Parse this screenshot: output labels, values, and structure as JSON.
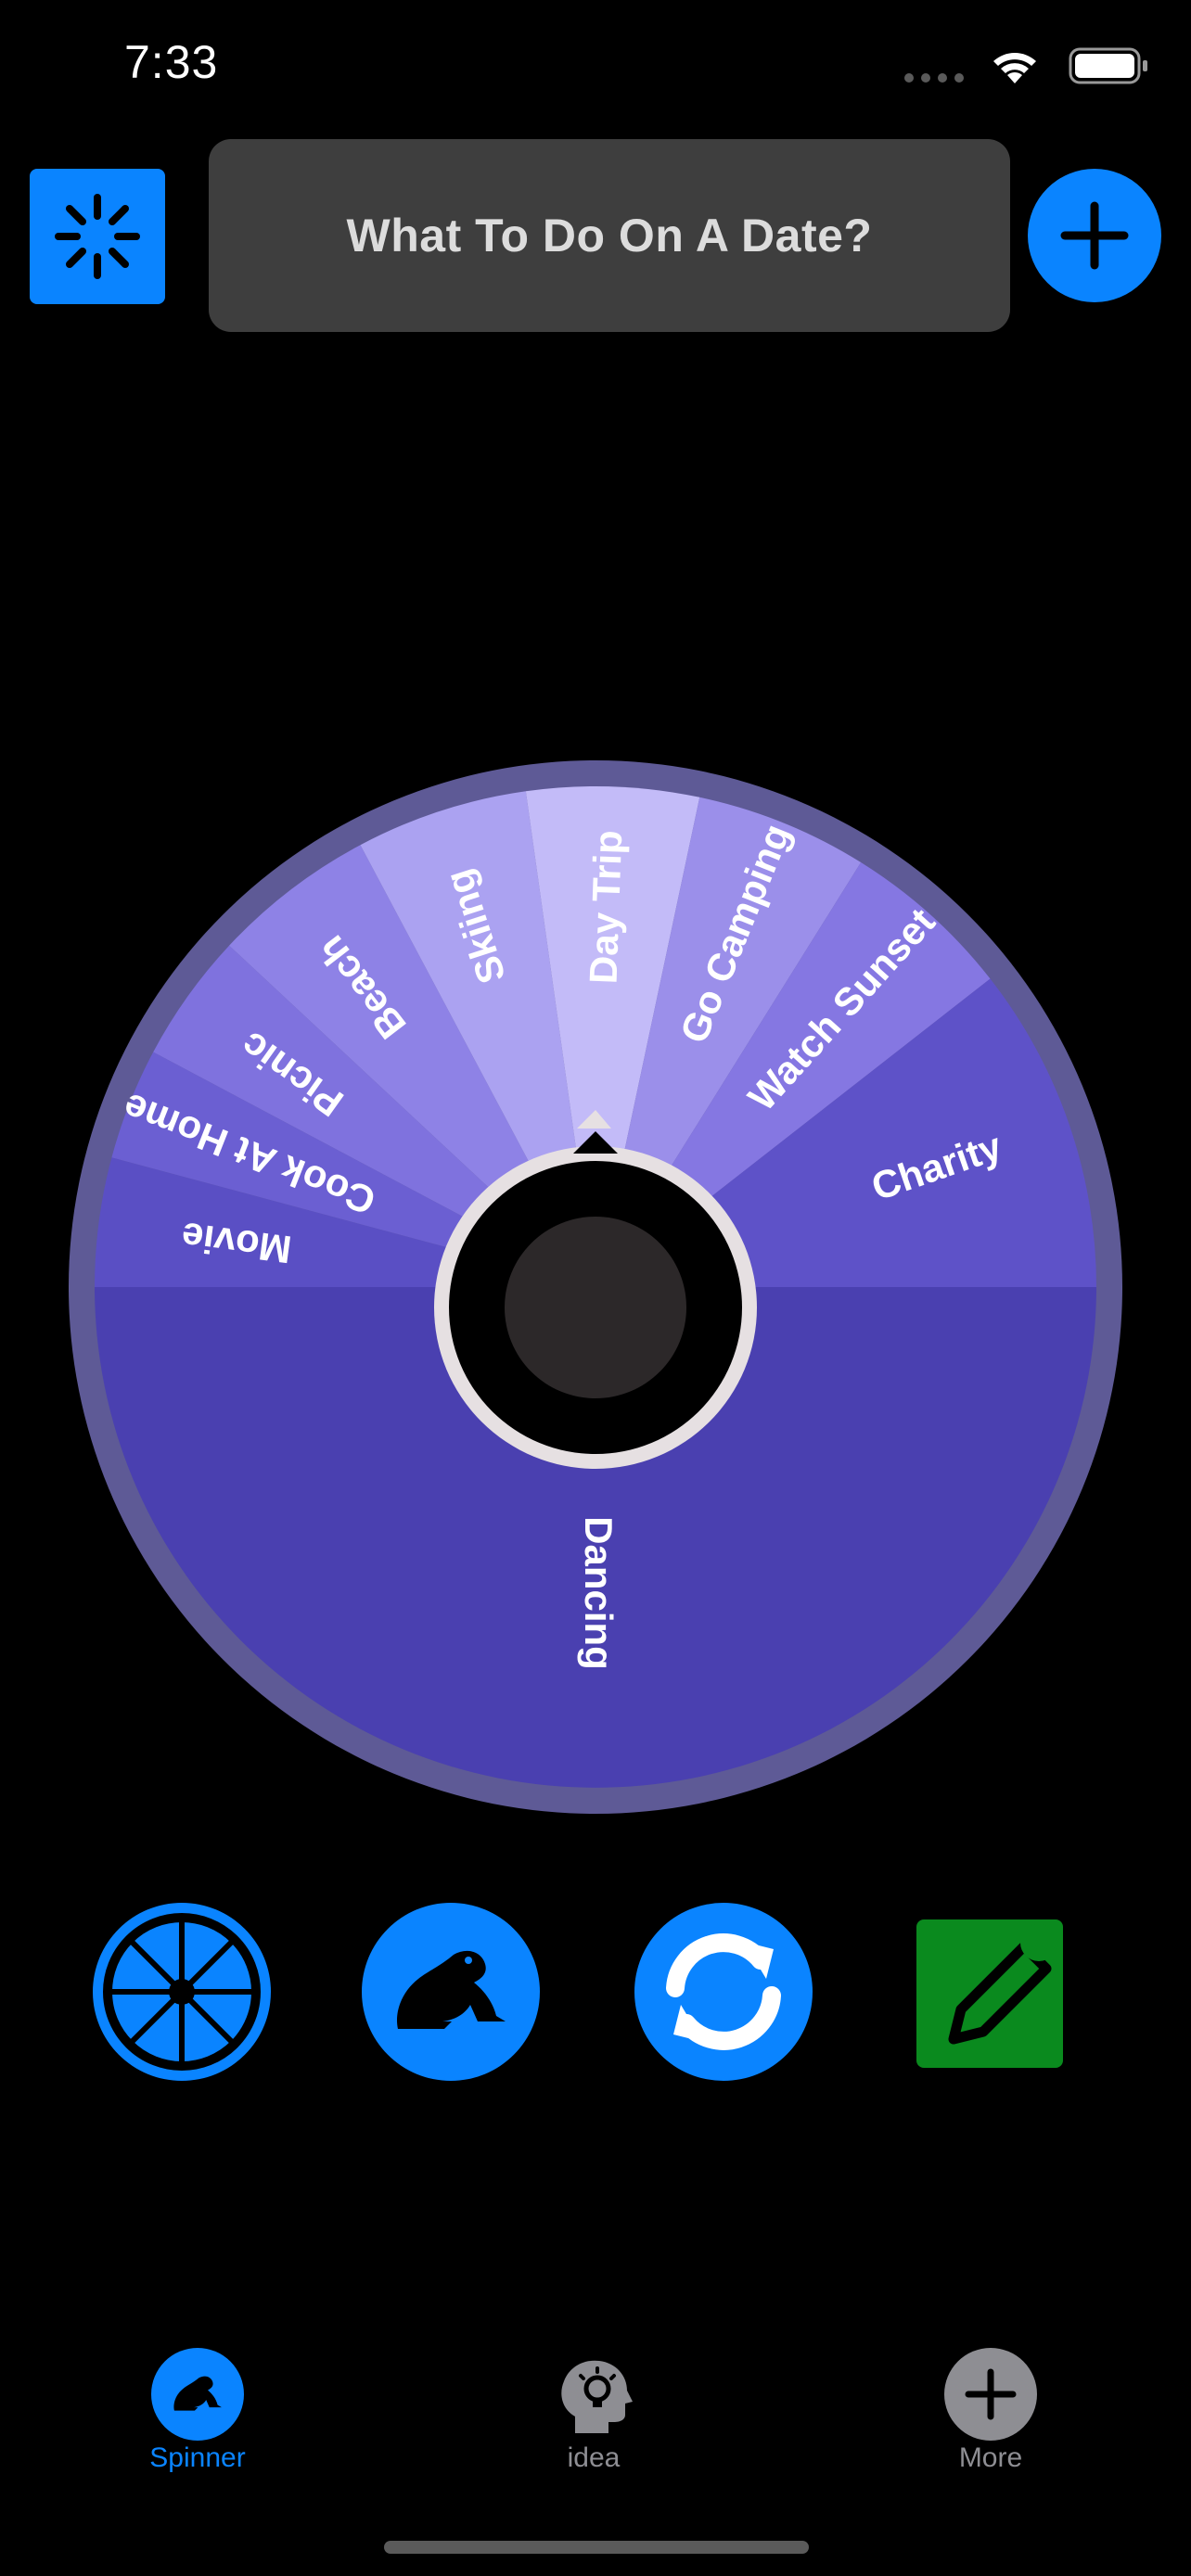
{
  "status_bar": {
    "time": "7:33"
  },
  "header": {
    "title": "What To Do On A Date?"
  },
  "wheel": {
    "slices": [
      {
        "label": "Dancing",
        "color": "#4A40B0"
      },
      {
        "label": "Movie",
        "color": "#5A4FC4"
      },
      {
        "label": "Cook At Home",
        "color": "#6B5FD2"
      },
      {
        "label": "Picnic",
        "color": "#7F72DE"
      },
      {
        "label": "Beach",
        "color": "#8E82E6"
      },
      {
        "label": "Skiing",
        "color": "#ABA2F1"
      },
      {
        "label": "Day Trip",
        "color": "#C3BBF8"
      },
      {
        "label": "Go Camping",
        "color": "#9B8FEA"
      },
      {
        "label": "Watch Sunset",
        "color": "#8577E2"
      },
      {
        "label": "Charity",
        "color": "#5E52C8"
      }
    ],
    "rim_color": "#5E5A96",
    "hub_color": "#2C2829",
    "hub_ring_color": "#E6E0E2"
  },
  "actions": {
    "wheel_style_icon": "wheel-icon",
    "spin_icon": "frog-icon",
    "reset_icon": "refresh-icon",
    "edit_icon": "pencil-icon"
  },
  "tabbar": {
    "tabs": [
      {
        "label": "Spinner",
        "icon": "frog-icon",
        "active": true
      },
      {
        "label": "idea",
        "icon": "head-lightbulb-icon",
        "active": false
      },
      {
        "label": "More",
        "icon": "plus-circle-icon",
        "active": false
      }
    ],
    "active_color": "#0A84FF",
    "inactive_color": "#8E8E93"
  }
}
